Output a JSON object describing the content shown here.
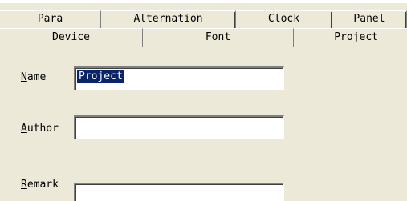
{
  "tabs_back": [
    {
      "label": "Para"
    },
    {
      "label": "Alternation"
    },
    {
      "label": "Clock"
    },
    {
      "label": "Panel"
    }
  ],
  "tabs_front": [
    {
      "label": "Device"
    },
    {
      "label": "Font"
    },
    {
      "label": "Project",
      "selected": true
    }
  ],
  "form": {
    "name": {
      "label_first": "N",
      "label_rest": "ame",
      "value": "Project"
    },
    "author": {
      "label_first": "A",
      "label_rest": "uthor",
      "value": ""
    },
    "remark": {
      "label_first": "R",
      "label_rest": "emark",
      "value": ""
    }
  }
}
